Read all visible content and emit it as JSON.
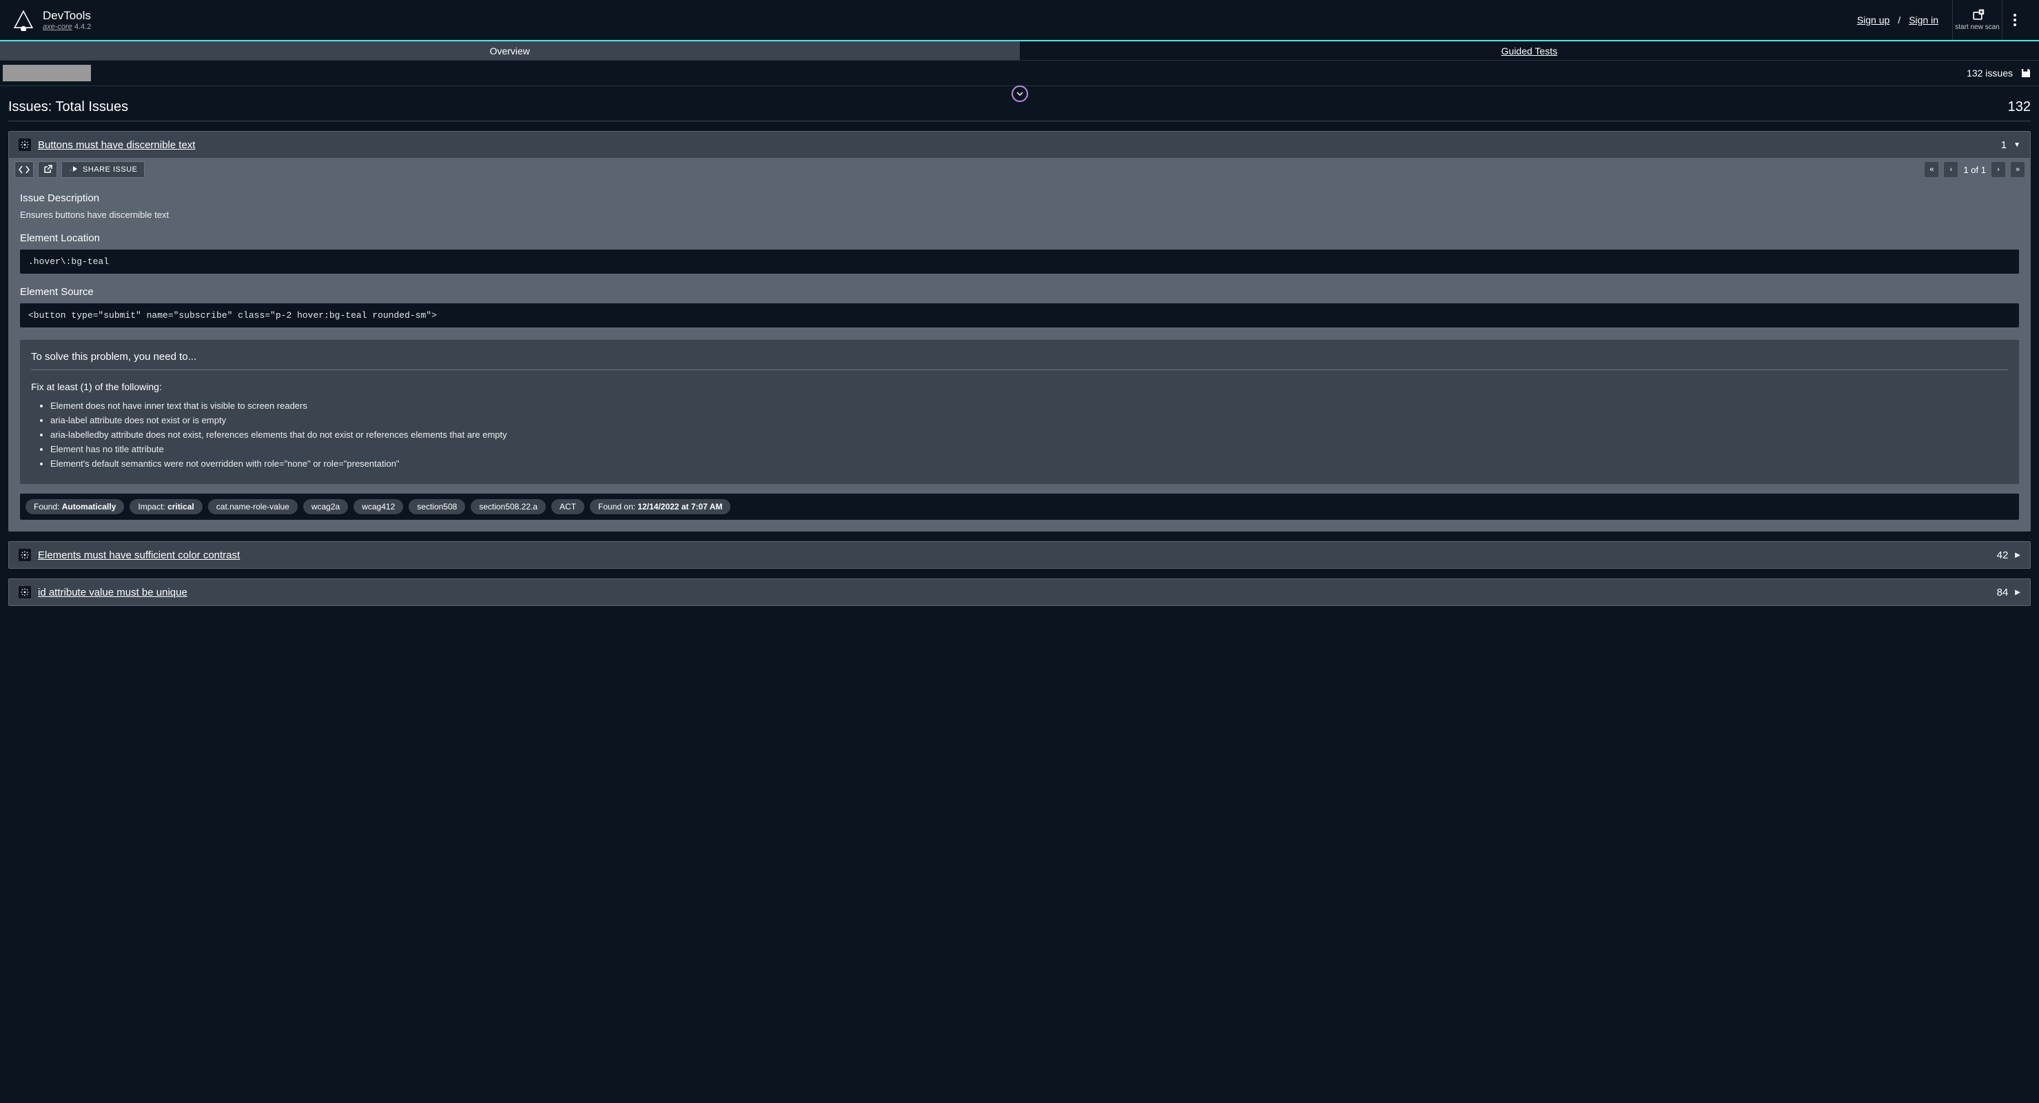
{
  "header": {
    "logo_title": "DevTools",
    "logo_link": "axe-core",
    "logo_version": "4.4.2",
    "sign_up": "Sign up",
    "sep": "/",
    "sign_in": "Sign in",
    "start_new_scan": "start new scan"
  },
  "tabs": {
    "overview": "Overview",
    "guided": "Guided Tests"
  },
  "toolbar": {
    "issues_summary": "132 issues"
  },
  "issues_header": {
    "title": "Issues: Total Issues",
    "count": "132"
  },
  "issue1": {
    "title": "Buttons must have discernible text",
    "count": "1",
    "share": "SHARE ISSUE",
    "pager": "1 of 1",
    "desc_label": "Issue Description",
    "desc_text": "Ensures buttons have discernible text",
    "loc_label": "Element Location",
    "loc_code": ".hover\\:bg-teal",
    "src_label": "Element Source",
    "src_code": "<button type=\"submit\" name=\"subscribe\" class=\"p-2 hover:bg-teal rounded-sm\">",
    "solution_title": "To solve this problem, you need to...",
    "fix_heading": "Fix at least (1) of the following:",
    "fixes": {
      "f0": "Element does not have inner text that is visible to screen readers",
      "f1": "aria-label attribute does not exist or is empty",
      "f2": "aria-labelledby attribute does not exist, references elements that do not exist or references elements that are empty",
      "f3": "Element has no title attribute",
      "f4": "Element's default semantics were not overridden with role=\"none\" or role=\"presentation\""
    },
    "chips": {
      "found_label": "Found: ",
      "found_val": "Automatically",
      "impact_label": "Impact: ",
      "impact_val": "critical",
      "t0": "cat.name-role-value",
      "t1": "wcag2a",
      "t2": "wcag412",
      "t3": "section508",
      "t4": "section508.22.a",
      "t5": "ACT",
      "foundon_label": "Found on: ",
      "foundon_val": "12/14/2022 at 7:07 AM"
    }
  },
  "issue2": {
    "title": "Elements must have sufficient color contrast",
    "count": "42"
  },
  "issue3": {
    "title": "id attribute value must be unique",
    "count": "84"
  }
}
